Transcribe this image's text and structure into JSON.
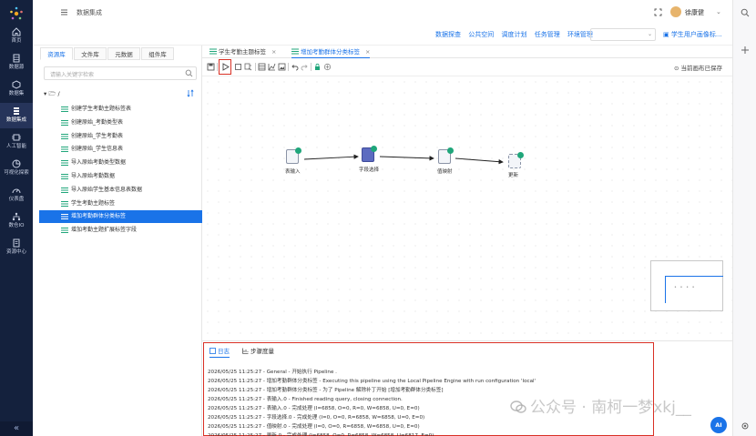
{
  "sidebar": {
    "items": [
      {
        "label": "首页",
        "icon": "home-icon"
      },
      {
        "label": "数据源",
        "icon": "database-icon"
      },
      {
        "label": "数据集",
        "icon": "dataset-icon"
      },
      {
        "label": "数据集成",
        "icon": "integration-icon"
      },
      {
        "label": "人工智能",
        "icon": "ai-icon"
      },
      {
        "label": "可视化探索",
        "icon": "chart-icon"
      },
      {
        "label": "仪表盘",
        "icon": "dashboard-icon"
      },
      {
        "label": "数仓IO",
        "icon": "warehouse-icon"
      },
      {
        "label": "资源中心",
        "icon": "resource-icon"
      }
    ],
    "active_index": 3,
    "collapse_glyph": "«"
  },
  "header": {
    "title": "数据集成",
    "user": "徐康健",
    "caret": "⌄"
  },
  "linkbar": {
    "links": [
      "数据探查",
      "公共空间",
      "调度计划",
      "任务管理",
      "环境管理"
    ],
    "select_value": "",
    "app_label": "学生用户画像标..."
  },
  "library": {
    "tabs": [
      "资源库",
      "文件库",
      "元数据",
      "组件库"
    ],
    "active_tab": 0,
    "search_placeholder": "请输入关键字检索",
    "root_label": "/",
    "items": [
      "创建学生考勤主题标签表",
      "创建原始_考勤类型表",
      "创建原始_学生考勤表",
      "创建原始_学生信息表",
      "导入原始考勤类型数据",
      "导入原始考勤数据",
      "导入原始学生基本信息表数据",
      "学生考勤主题标签",
      "增加考勤群体分类标签",
      "增加考勤主题扩展标签字段"
    ],
    "active_item": 8
  },
  "editor": {
    "tabs": [
      {
        "label": "学生考勤主题标签",
        "close": "×"
      },
      {
        "label": "增加考勤群体分类标签",
        "close": "×"
      }
    ],
    "active_tab": 1,
    "saved_status": "当前画布已保存"
  },
  "canvas": {
    "nodes": [
      {
        "label": "表输入",
        "color": "#1a73e8"
      },
      {
        "label": "字段选择",
        "color": "#5c6bc0"
      },
      {
        "label": "值映射",
        "color": "#1a73e8"
      },
      {
        "label": "更新",
        "color": "#1a73e8"
      }
    ]
  },
  "log": {
    "tabs": [
      "日志",
      "步骤度量"
    ],
    "active_tab": 0,
    "lines": [
      "2026/05/25 11:25:27 - General - 开始执行 Pipeline .",
      "2026/05/25 11:25:27 - 增加考勤群体分类标签 - Executing this pipeline using the Local Pipeline Engine with run configuration 'local'",
      "2026/05/25 11:25:27 - 增加考勤群体分类标签 - 为了 Pipeline 解除补丁开始 [增加考勤群体分类标签]",
      "2026/05/25 11:25:27 - 表输入.0 - Finished reading query, closing connection.",
      "2026/05/25 11:25:27 - 表输入.0 - 完成处理 (I=6858, O=0, R=0, W=6858, U=0, E=0)",
      "2026/05/25 11:25:27 - 字段选择.0 - 完成处理 (I=0, O=0, R=6858, W=6858, U=0, E=0)",
      "2026/05/25 11:25:27 - 值映射.0 - 完成处理 (I=0, O=0, R=6858, W=6858, U=0, E=0)",
      "2026/05/25 11:25:27 - 更新.0 - 完成处理 (I=6858, O=0, R=6858, W=6858, U=6817, E=0)"
    ]
  },
  "watermark": "公众号 · 南柯一梦xkj__",
  "ai_label": "AI",
  "colors": {
    "sidebar_bg": "#14213d",
    "accent": "#1a73e8",
    "highlight": "#d93025",
    "success": "#1fa67a"
  }
}
